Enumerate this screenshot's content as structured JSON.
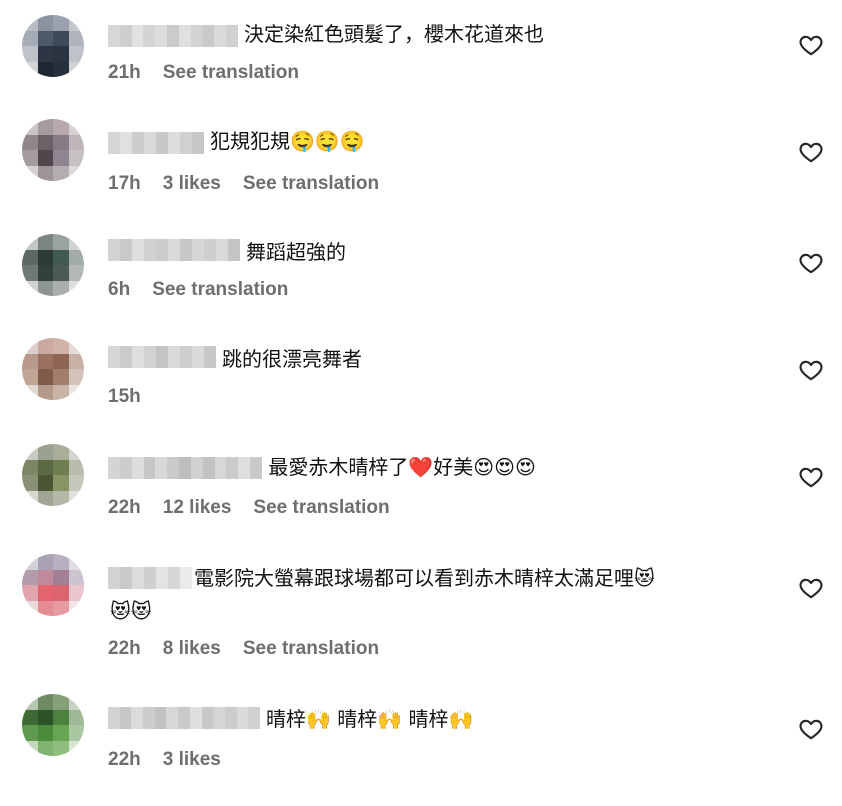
{
  "comments": [
    {
      "text": "決定染紅色頭髮了，櫻木花道來也",
      "time": "21h",
      "likes": "",
      "translate": "See translation"
    },
    {
      "text": "犯規犯規🤤🤤🤤",
      "time": "17h",
      "likes": "3 likes",
      "translate": "See translation"
    },
    {
      "text": "舞蹈超強的",
      "time": "6h",
      "likes": "",
      "translate": "See translation"
    },
    {
      "text": "跳的很漂亮舞者",
      "time": "15h",
      "likes": "",
      "translate": ""
    },
    {
      "text": " 最愛赤木晴梓了❤️好美😍😍😍",
      "time": "22h",
      "likes": "12 likes",
      "translate": "See translation"
    },
    {
      "text": "電影院大螢幕跟球場都可以看到赤木晴梓太滿足哩😻\n😻😻",
      "time": "22h",
      "likes": "8 likes",
      "translate": "See translation"
    },
    {
      "text": "晴梓🙌 晴梓🙌 晴梓🙌",
      "time": "22h",
      "likes": "3 likes",
      "translate": ""
    }
  ],
  "icons": {
    "like": "heart-outline-icon"
  },
  "colors": {
    "meta": "#6e6e6e",
    "text": "#111111"
  }
}
